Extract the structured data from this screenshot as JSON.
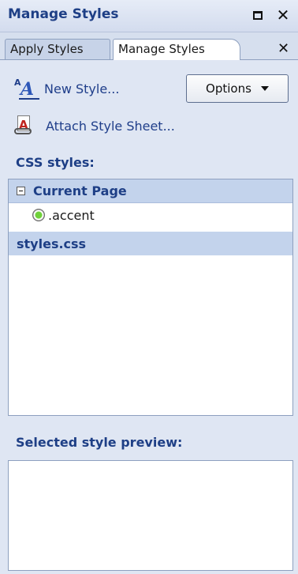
{
  "window": {
    "title": "Manage Styles"
  },
  "tabs": [
    {
      "label": "Apply Styles"
    },
    {
      "label": "Manage Styles"
    }
  ],
  "toolbar": {
    "new_style_label": "New Style...",
    "attach_label": "Attach Style Sheet...",
    "options_label": "Options"
  },
  "css_styles": {
    "label": "CSS styles:",
    "current_page": "Current Page",
    "rules": [
      ".accent"
    ],
    "stylesheet": "styles.css"
  },
  "preview": {
    "label": "Selected style preview:"
  }
}
